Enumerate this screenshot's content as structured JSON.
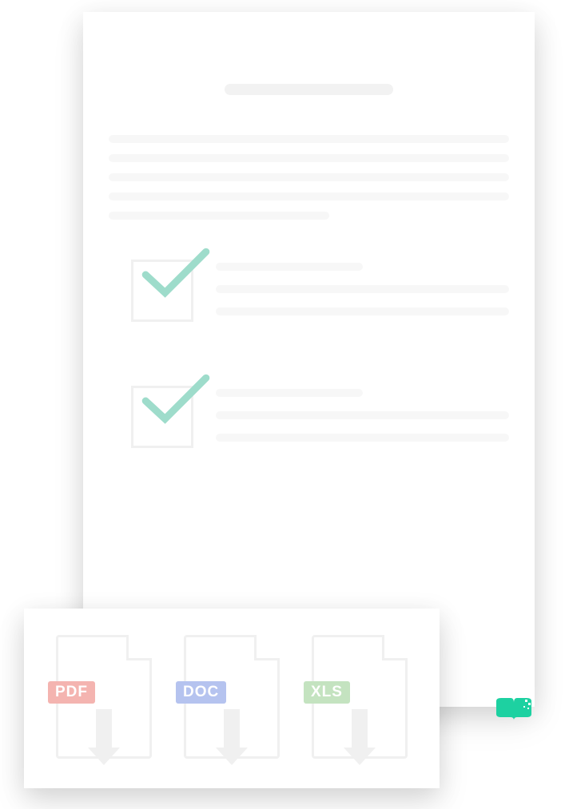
{
  "downloads": {
    "pdf_label": "PDF",
    "doc_label": "DOC",
    "xls_label": "XLS"
  },
  "colors": {
    "accent": "#1dd1a1",
    "pdf": "#f4b4b0",
    "doc": "#b5c3ef",
    "xls": "#c4e3c0",
    "checkmark": "#9edccb"
  }
}
